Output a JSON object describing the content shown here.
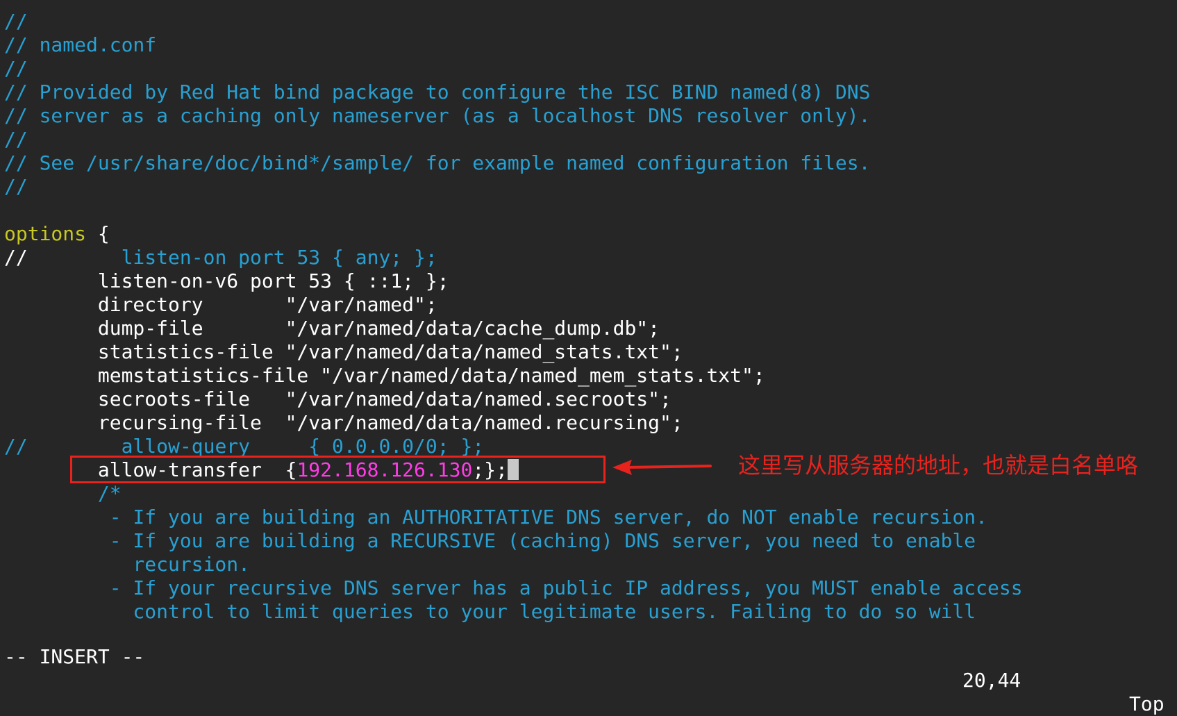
{
  "editor": {
    "lines": [
      "//",
      "// named.conf",
      "//",
      "// Provided by Red Hat bind package to configure the ISC BIND named(8) DNS",
      "// server as a caching only nameserver (as a localhost DNS resolver only).",
      "//",
      "// See /usr/share/doc/bind*/sample/ for example named configuration files.",
      "//",
      "",
      "options",
      " {",
      "//",
      "        listen-on port 53 { any; };",
      "        listen-on-v6 port 53 { ::1; };",
      "        directory       \"/var/named\";",
      "        dump-file       \"/var/named/data/cache_dump.db\";",
      "        statistics-file \"/var/named/data/named_stats.txt\";",
      "        memstatistics-file \"/var/named/data/named_mem_stats.txt\";",
      "        secroots-file   \"/var/named/data/named.secroots\";",
      "        recursing-file  \"/var/named/data/named.recursing\";",
      "//",
      "        allow-query     { 0.0.0.0/0; };",
      "        allow-transfer  {",
      "192.168.126.130",
      ";};",
      "        /*",
      "         - If you are building an AUTHORITATIVE DNS server, do NOT enable recursion.",
      "         - If you are building a RECURSIVE (caching) DNS server, you need to enable",
      "           recursion.",
      "         - If your recursive DNS server has a public IP address, you MUST enable access",
      "           control to limit queries to your legitimate users. Failing to do so will"
    ]
  },
  "status": {
    "mode": "-- INSERT --",
    "position": "20,44",
    "scroll": "Top"
  },
  "annotation": {
    "text": "这里写从服务器的地址，也就是白名单咯"
  },
  "colors": {
    "background": "#262626",
    "comment": "#28a0d2",
    "keyword": "#c8c820",
    "literal": "#ff3ce6",
    "annotation": "#e8231e"
  }
}
